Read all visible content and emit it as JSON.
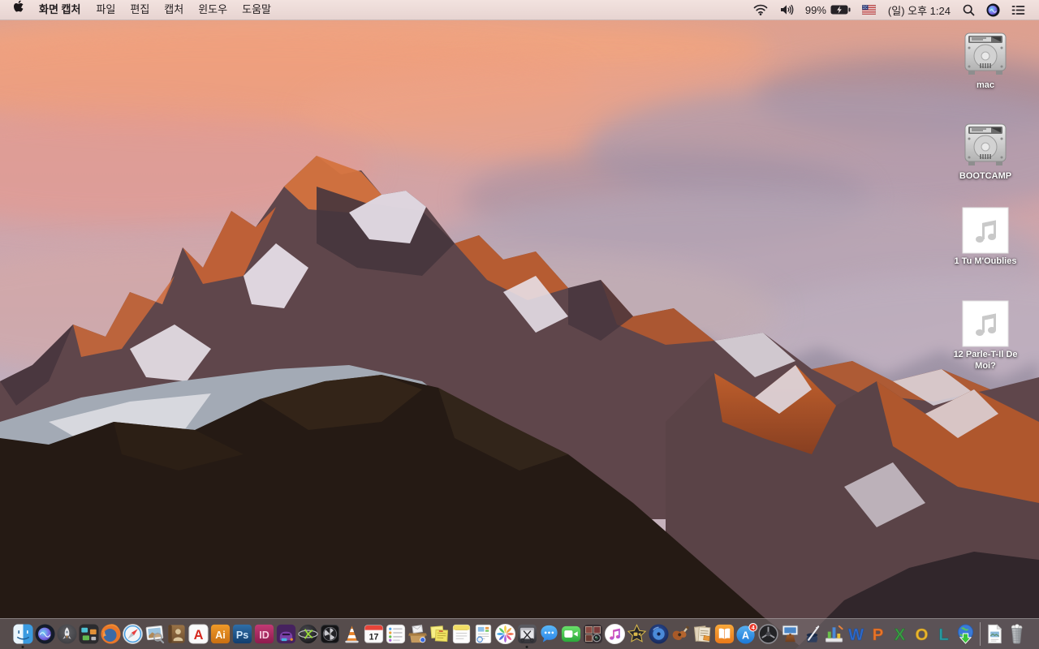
{
  "menu_bar": {
    "app_name": "화면 캡처",
    "menus": [
      "파일",
      "편집",
      "캡처",
      "윈도우",
      "도움말"
    ],
    "battery_percent": "99%",
    "clock": "(일) 오후 1:24",
    "status_icons": [
      "wifi-icon",
      "volume-icon",
      "battery-charging-icon",
      "us-flag-icon",
      "spotlight-search-icon",
      "siri-icon",
      "notification-center-icon"
    ]
  },
  "desktop_icons": [
    {
      "label": "mac",
      "type": "hard-drive"
    },
    {
      "label": "BOOTCAMP",
      "type": "hard-drive"
    },
    {
      "label": "1 Tu M'Oublies",
      "type": "audio-file"
    },
    {
      "label": "12 Parle-T-Il De Moi?",
      "type": "audio-file"
    }
  ],
  "dock": {
    "glyphs": {
      "acrobat": "A",
      "illustrator": "Ai",
      "photoshop": "Ps",
      "indesign": "ID",
      "calendar_day": "17",
      "app_store_letter": "A",
      "app_store_badge": "4",
      "word": "W",
      "powerpoint": "P",
      "excel": "X",
      "outlook": "O",
      "lync": "L"
    },
    "running_apps": [
      "Finder",
      "화면 캡처"
    ],
    "apps": [
      "Finder",
      "Siri",
      "Launchpad",
      "Mission Control",
      "Firefox",
      "Safari",
      "Preview",
      "Address Book",
      "Adobe Acrobat Reader",
      "Adobe Illustrator",
      "Adobe Photoshop",
      "Adobe InDesign",
      "Toast",
      "Media Sphere App",
      "Fan Utility App",
      "VLC",
      "Calendar",
      "Reminders",
      "Mail Archive App",
      "Stickies",
      "Notes",
      "Document App",
      "Photos",
      "화면 캡처",
      "Messages",
      "FaceTime",
      "Photo Booth",
      "iTunes",
      "iMovie",
      "DVD App",
      "GarageBand",
      "Projects App",
      "iBooks",
      "App Store",
      "Dial App",
      "Keynote",
      "Pages",
      "Numbers",
      "Microsoft Word",
      "Microsoft PowerPoint",
      "Microsoft Excel",
      "Microsoft Outlook",
      "Microsoft Lync",
      "Web Downloader",
      "Document File",
      "Trash"
    ]
  },
  "colors": {
    "menu_bar_bg": "#eddcd9",
    "dock_bg": "rgba(122,113,117,0.58)",
    "sky_salmon": "#ef9f7e",
    "sky_lavender": "#b5a9bc",
    "mountain_orange": "#cd6a38",
    "rock_dark": "#251a14"
  }
}
